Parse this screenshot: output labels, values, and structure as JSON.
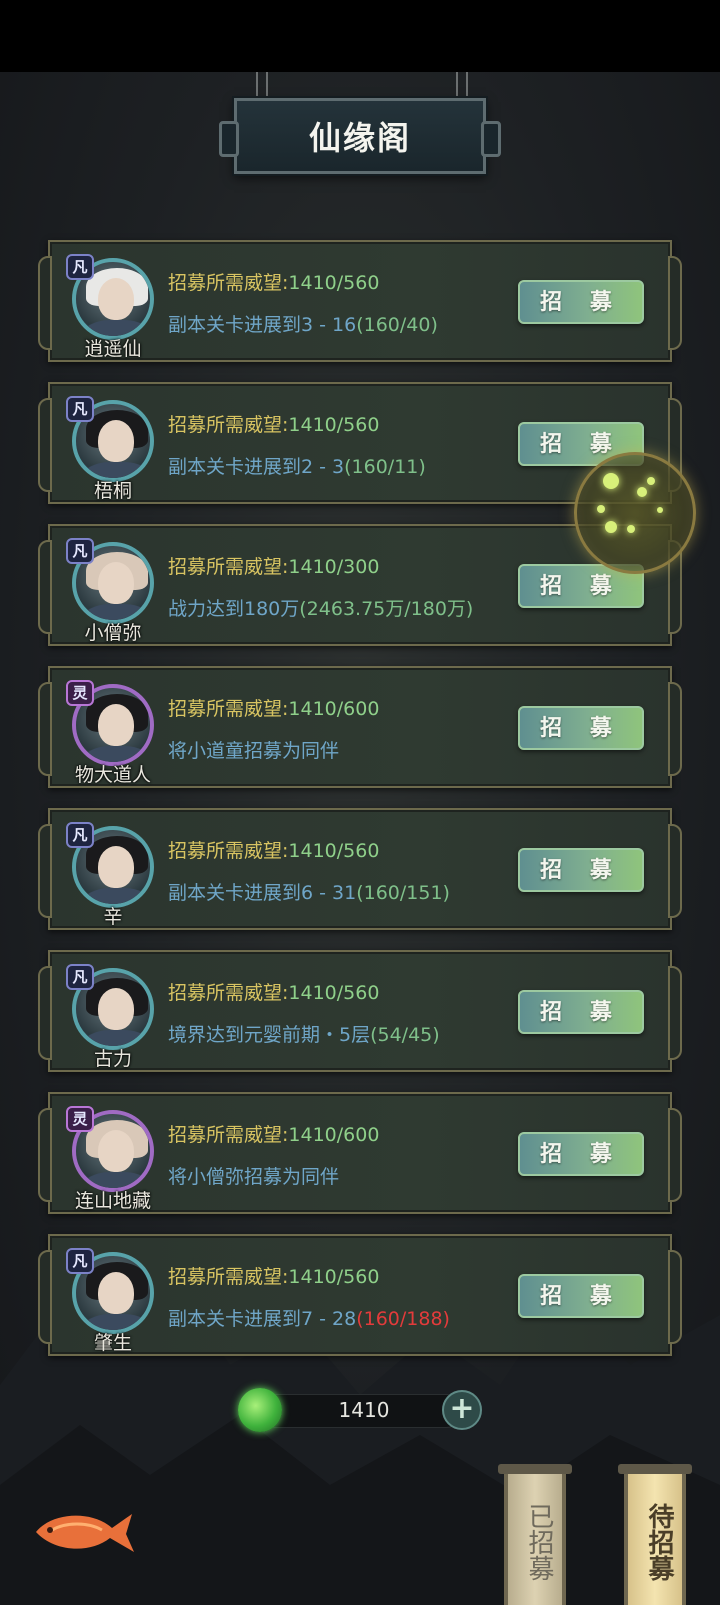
{
  "title": "仙缘阁",
  "button_label": "招 募",
  "cards": [
    {
      "rank": "凡",
      "rank_type": "fan",
      "name": "逍遥仙",
      "prestige_label": "招募所需威望:",
      "prestige_value": "1410/560",
      "cond_text": "副本关卡进展到3 - 16",
      "cond_progress": "(160/40)",
      "progress_ok": true
    },
    {
      "rank": "凡",
      "rank_type": "fan",
      "name": "梧桐",
      "prestige_label": "招募所需威望:",
      "prestige_value": "1410/560",
      "cond_text": "副本关卡进展到2 - 3",
      "cond_progress": "(160/11)",
      "progress_ok": true
    },
    {
      "rank": "凡",
      "rank_type": "fan",
      "name": "小僧弥",
      "prestige_label": "招募所需威望:",
      "prestige_value": "1410/300",
      "cond_text": "战力达到180万",
      "cond_progress": "(2463.75万/180万)",
      "progress_ok": true
    },
    {
      "rank": "灵",
      "rank_type": "ling",
      "name": "物大道人",
      "prestige_label": "招募所需威望:",
      "prestige_value": "1410/600",
      "cond_text": "将小道童招募为同伴",
      "cond_progress": "",
      "progress_ok": true
    },
    {
      "rank": "凡",
      "rank_type": "fan",
      "name": "辛",
      "prestige_label": "招募所需威望:",
      "prestige_value": "1410/560",
      "cond_text": "副本关卡进展到6 - 31",
      "cond_progress": "(160/151)",
      "progress_ok": true
    },
    {
      "rank": "凡",
      "rank_type": "fan",
      "name": "古力",
      "prestige_label": "招募所需威望:",
      "prestige_value": "1410/560",
      "cond_text": "境界达到元婴前期・5层",
      "cond_progress": "(54/45)",
      "progress_ok": true
    },
    {
      "rank": "灵",
      "rank_type": "ling",
      "name": "连山地藏",
      "prestige_label": "招募所需威望:",
      "prestige_value": "1410/600",
      "cond_text": "将小僧弥招募为同伴",
      "cond_progress": "",
      "progress_ok": true
    },
    {
      "rank": "凡",
      "rank_type": "fan",
      "name": "肇生",
      "prestige_label": "招募所需威望:",
      "prestige_value": "1410/560",
      "cond_text": "副本关卡进展到7 - 28",
      "cond_progress": "(160/188)",
      "progress_ok": false
    }
  ],
  "currency": {
    "value": "1410",
    "plus": "+"
  },
  "tabs": {
    "recruited": "已招募",
    "pending": "待招募"
  },
  "colors": {
    "accent_gold": "#d8c462",
    "ok_green": "#8fd08a",
    "fail_red": "#e33b3b",
    "cond_blue": "#6fa6c8"
  }
}
